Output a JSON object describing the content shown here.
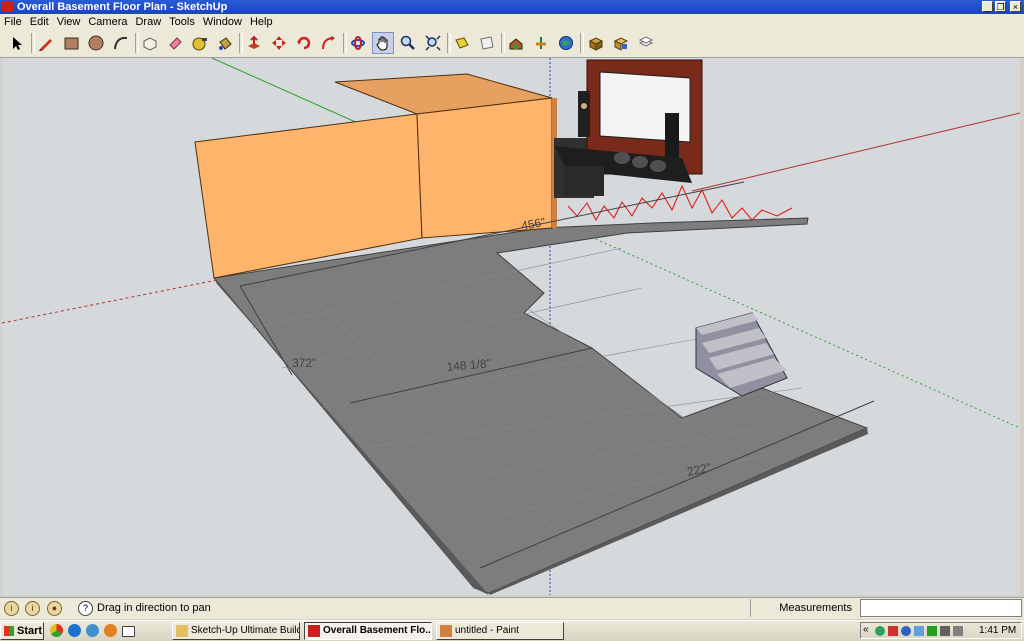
{
  "window": {
    "title": "Overall Basement Floor Plan - SketchUp",
    "controls": [
      "_",
      "❐",
      "×"
    ]
  },
  "menu": [
    "File",
    "Edit",
    "View",
    "Camera",
    "Draw",
    "Tools",
    "Window",
    "Help"
  ],
  "toolbar": {
    "tools": [
      "select-icon",
      "pencil-icon",
      "rectangle-icon",
      "circle-icon",
      "arc-icon",
      "make-component-icon",
      "eraser-icon",
      "tape-measure-icon",
      "paint-bucket-icon",
      "push-pull-icon",
      "move-icon",
      "rotate-icon",
      "follow-me-icon",
      "orbit-icon",
      "pan-icon",
      "zoom-icon",
      "zoom-extents-icon",
      "get-models-icon",
      "share-model-icon",
      "warehouse-icon",
      "add-location-icon",
      "google-earth-icon",
      "components-icon",
      "styles-icon",
      "layers-icon"
    ],
    "active_tool": "pan-icon"
  },
  "canvas": {
    "dimensions": [
      "456\"",
      "372\"",
      "148 1/8\"",
      "222\""
    ]
  },
  "status": {
    "hint": "Drag in direction to pan",
    "measurements_label": "Measurements",
    "measurements_value": ""
  },
  "taskbar": {
    "start_label": "Start",
    "tasks": [
      {
        "label": "Sketch-Up Ultimate Build",
        "active": false
      },
      {
        "label": "Overall Basement Flo...",
        "active": true
      },
      {
        "label": "untitled - Paint",
        "active": false
      }
    ],
    "tray_chevron": "«",
    "clock": "1:41 PM"
  },
  "colors": {
    "title_bar": "#1c45b8",
    "sky": "#d5d9db",
    "wall": "#ffb46c",
    "floor": "#7a7a7a",
    "axis_red": "#b03030",
    "axis_green": "#30a030",
    "axis_blue": "#3040c0",
    "graph_line": "#e01010"
  }
}
